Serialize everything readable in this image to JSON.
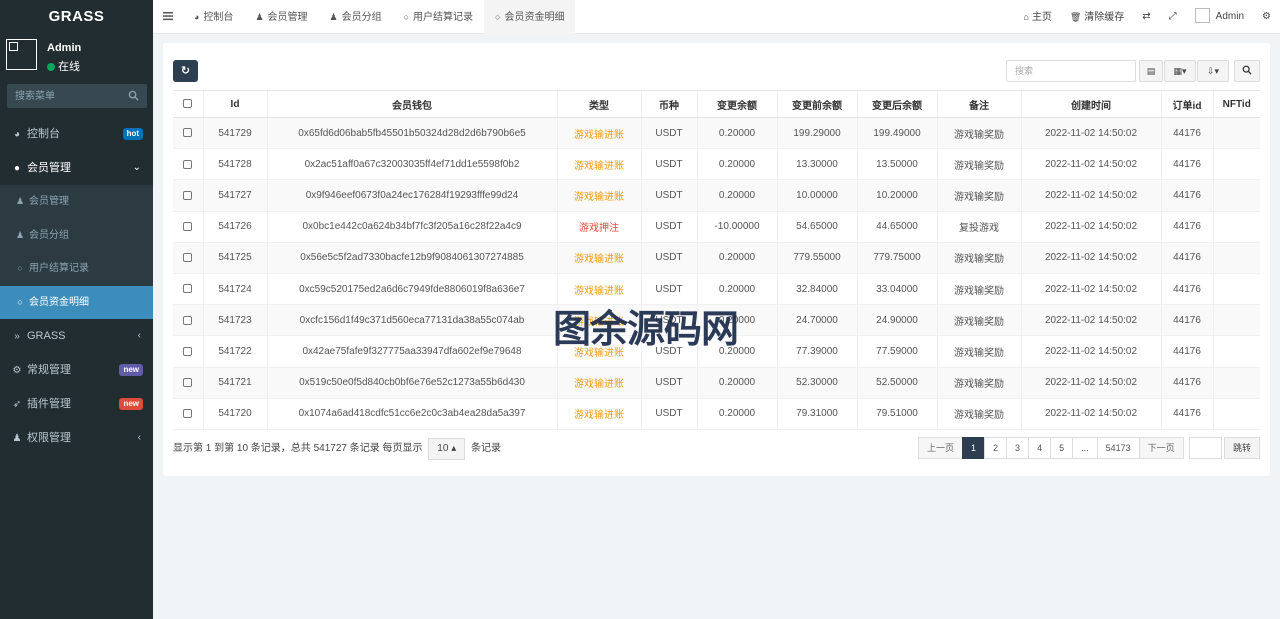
{
  "brand": "GRASS",
  "user": {
    "name": "Admin",
    "status": "在线"
  },
  "sidebar": {
    "search_placeholder": "搜索菜单",
    "items": [
      {
        "label": "控制台",
        "badge": "hot"
      },
      {
        "label": "会员管理"
      },
      {
        "label": "GRASS"
      },
      {
        "label": "常规管理",
        "badge": "new"
      },
      {
        "label": "插件管理",
        "badge": "new"
      },
      {
        "label": "权限管理"
      }
    ],
    "submenu": [
      {
        "label": "会员管理"
      },
      {
        "label": "会员分组"
      },
      {
        "label": "用户结算记录"
      },
      {
        "label": "会员资金明细"
      }
    ]
  },
  "tabs": [
    {
      "label": "控制台"
    },
    {
      "label": "会员管理"
    },
    {
      "label": "会员分组"
    },
    {
      "label": "用户结算记录"
    },
    {
      "label": "会员资金明细"
    }
  ],
  "topright": {
    "home": "主页",
    "clear_cache": "清除缓存",
    "user": "Admin"
  },
  "toolbar": {
    "search_placeholder": "搜索"
  },
  "table": {
    "headers": [
      "Id",
      "会员钱包",
      "类型",
      "币种",
      "变更余额",
      "变更前余额",
      "变更后余额",
      "备注",
      "创建时间",
      "订单id",
      "NFTid"
    ],
    "rows": [
      [
        "541729",
        "0x65fd6d06bab5fb45501b50324d28d2d6b790b6e5",
        "游戏输进账",
        "USDT",
        "0.20000",
        "199.29000",
        "199.49000",
        "游戏输奖励",
        "2022-11-02 14:50:02",
        "44176",
        ""
      ],
      [
        "541728",
        "0x2ac51aff0a67c32003035ff4ef71dd1e5598f0b2",
        "游戏输进账",
        "USDT",
        "0.20000",
        "13.30000",
        "13.50000",
        "游戏输奖励",
        "2022-11-02 14:50:02",
        "44176",
        ""
      ],
      [
        "541727",
        "0x9f946eef0673f0a24ec176284f19293fffe99d24",
        "游戏输进账",
        "USDT",
        "0.20000",
        "10.00000",
        "10.20000",
        "游戏输奖励",
        "2022-11-02 14:50:02",
        "44176",
        ""
      ],
      [
        "541726",
        "0x0bc1e442c0a624b34bf7fc3f205a16c28f22a4c9",
        "游戏押注",
        "USDT",
        "-10.00000",
        "54.65000",
        "44.65000",
        "复投游戏",
        "2022-11-02 14:50:02",
        "44176",
        ""
      ],
      [
        "541725",
        "0x56e5c5f2ad7330bacfe12b9f9084061307274885",
        "游戏输进账",
        "USDT",
        "0.20000",
        "779.55000",
        "779.75000",
        "游戏输奖励",
        "2022-11-02 14:50:02",
        "44176",
        ""
      ],
      [
        "541724",
        "0xc59c520175ed2a6d6c7949fde8806019f8a636e7",
        "游戏输进账",
        "USDT",
        "0.20000",
        "32.84000",
        "33.04000",
        "游戏输奖励",
        "2022-11-02 14:50:02",
        "44176",
        ""
      ],
      [
        "541723",
        "0xcfc156d1f49c371d560eca77131da38a55c074ab",
        "游戏输进账",
        "USDT",
        "0.20000",
        "24.70000",
        "24.90000",
        "游戏输奖励",
        "2022-11-02 14:50:02",
        "44176",
        ""
      ],
      [
        "541722",
        "0x42ae75fafe9f327775aa33947dfa602ef9e79648",
        "游戏输进账",
        "USDT",
        "0.20000",
        "77.39000",
        "77.59000",
        "游戏输奖励",
        "2022-11-02 14:50:02",
        "44176",
        ""
      ],
      [
        "541721",
        "0x519c50e0f5d840cb0bf6e76e52c1273a55b6d430",
        "游戏输进账",
        "USDT",
        "0.20000",
        "52.30000",
        "52.50000",
        "游戏输奖励",
        "2022-11-02 14:50:02",
        "44176",
        ""
      ],
      [
        "541720",
        "0x1074a6ad418cdfc51cc6e2c0c3ab4ea28da5a397",
        "游戏输进账",
        "USDT",
        "0.20000",
        "79.31000",
        "79.51000",
        "游戏输奖励",
        "2022-11-02 14:50:02",
        "44176",
        ""
      ]
    ]
  },
  "footer": {
    "info_before": "显示第 1 到第 10 条记录，总共 541727 条记录 每页显示",
    "page_size": "10",
    "info_after": "条记录"
  },
  "pagination": {
    "prev": "上一页",
    "pages": [
      "1",
      "2",
      "3",
      "4",
      "5",
      "...",
      "54173"
    ],
    "next": "下一页",
    "go": "跳转"
  },
  "watermark": "图余源码网",
  "colors": {
    "sidebar_bg": "#222d32",
    "active": "#3c8dbc",
    "accent": "#2c3e50",
    "type_income": "#f39c12",
    "type_bet": "#e74c3c"
  }
}
